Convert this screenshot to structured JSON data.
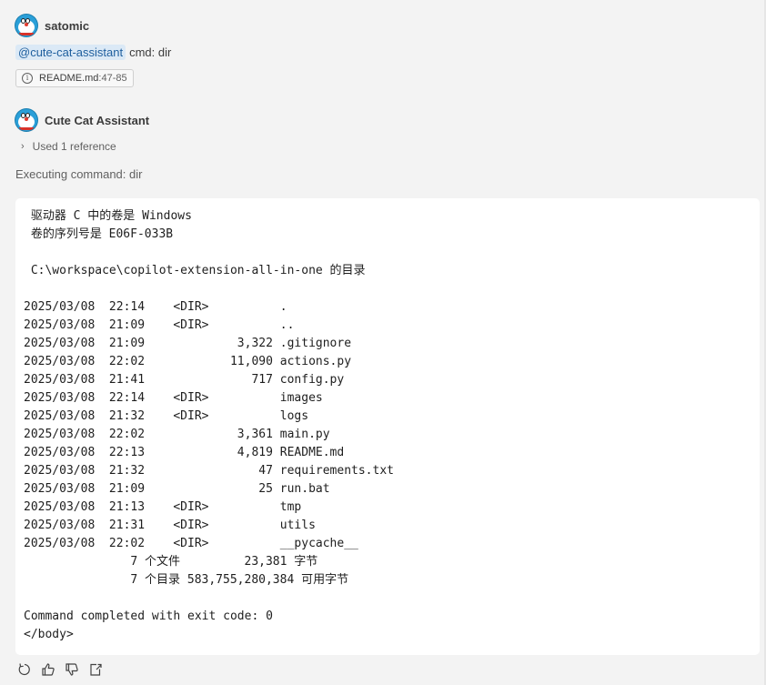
{
  "user_message": {
    "username": "satomic",
    "mention": "@cute-cat-assistant",
    "command": "cmd: dir",
    "reference_chip": {
      "icon": "info-icon",
      "file": "README.md",
      "lines": ":47-85"
    }
  },
  "assistant_message": {
    "name": "Cute Cat Assistant",
    "used_reference": "Used 1 reference",
    "executing": "Executing command: dir",
    "output_lines": [
      " 驱动器 C 中的卷是 Windows",
      " 卷的序列号是 E06F-033B",
      "",
      " C:\\workspace\\copilot-extension-all-in-one 的目录",
      "",
      "2025/03/08  22:14    <DIR>          .",
      "2025/03/08  21:09    <DIR>          ..",
      "2025/03/08  21:09             3,322 .gitignore",
      "2025/03/08  22:02            11,090 actions.py",
      "2025/03/08  21:41               717 config.py",
      "2025/03/08  22:14    <DIR>          images",
      "2025/03/08  21:32    <DIR>          logs",
      "2025/03/08  22:02             3,361 main.py",
      "2025/03/08  22:13             4,819 README.md",
      "2025/03/08  21:32                47 requirements.txt",
      "2025/03/08  21:09                25 run.bat",
      "2025/03/08  21:13    <DIR>          tmp",
      "2025/03/08  21:31    <DIR>          utils",
      "2025/03/08  22:02    <DIR>          __pycache__",
      "               7 个文件         23,381 字节",
      "               7 个目录 583,755,280,384 可用字节",
      "",
      "Command completed with exit code: 0",
      "</body>"
    ]
  },
  "actions": [
    {
      "name": "retry-icon"
    },
    {
      "name": "thumbs-up-icon"
    },
    {
      "name": "thumbs-down-icon"
    },
    {
      "name": "insert-into-new-file-icon"
    }
  ]
}
